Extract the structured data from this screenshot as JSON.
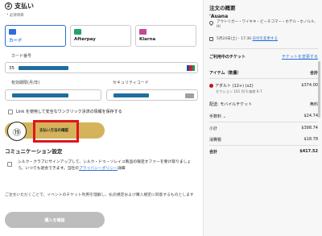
{
  "payment": {
    "step_number": "2",
    "title": "支払い",
    "required_note": "* 必須項目",
    "tabs": [
      {
        "label": "カード",
        "icon": "card-icon",
        "color": "#2a6fd6",
        "active": true
      },
      {
        "label": "Afterpay",
        "icon": "afterpay-icon",
        "color": "#1ea56a",
        "active": false
      },
      {
        "label": "Klarna",
        "icon": "klarna-icon",
        "color": "#c3489a",
        "active": false
      }
    ],
    "card_number_label": "カード番号",
    "card_number_prefix": "35",
    "card_brand_icon": "jcb-icon",
    "expiry_label": "有効期限(月/年)",
    "cvc_label": "セキュリティコード",
    "save_link_label": "Link を使用して安全なワンクリック決済の情報を保存する",
    "confirm_button_label": "支払い方法の確認",
    "step_annotation": "⑲"
  },
  "communication": {
    "title": "コミュニケーション設定",
    "text_prefix": "シルク・クラブにサインアップして、シルク・ドゥ・ソレイユ製品の限定オファーを受け取りましょう。いつでも退会できます。当社の",
    "privacy_link": "プライバシーポリシー",
    "text_suffix": "詳細"
  },
  "notice": "ご注文いただくことで、イベントのチケット利用を理解し、払戻規定および購入規定に同意するものとします",
  "buy_button_label": "購入を確認",
  "summary": {
    "title": "注文の概要",
    "event_name": "'Auana",
    "address": "アウトリガー・ワイキキ・ビーチコマー・ホテル・ホノルル, HI",
    "address_sub": "",
    "date": "5月24日(土) - 17:30",
    "change_date_link": "日付を変更する",
    "your_tickets_label": "ご利用中のチケット",
    "change_tickets_link": "チケットを変更する",
    "item_header": "アイテム（数量）",
    "total_header": "合計",
    "ticket_line": "アダルト (12+) (x2)",
    "ticket_price": "$374.00",
    "ticket_sub": "セクション 101 列 S 座席 6-7",
    "delivery_label": "配送: モバイルチケット",
    "delivery_price": "無料",
    "fee_label": "手数料",
    "fee_price": "$24.74",
    "subtotal_label": "小計",
    "subtotal_price": "$398.74",
    "tax_label": "消費税",
    "tax_price": "$18.78",
    "grand_label": "合計",
    "grand_price": "$417.52",
    "accent_color": "#c0151f"
  }
}
